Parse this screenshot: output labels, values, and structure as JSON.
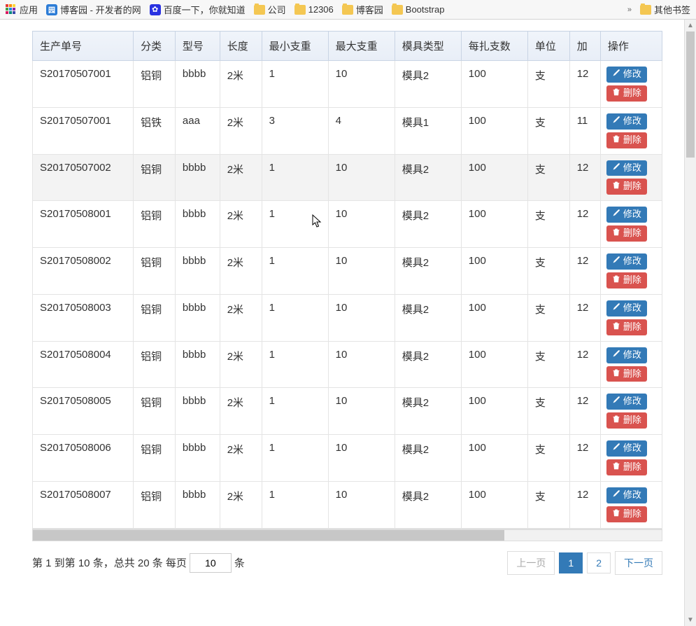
{
  "bookmarks": {
    "apps": "应用",
    "cnblogs": "博客园 - 开发者的网",
    "baidu": "百度一下，你就知道",
    "folders": [
      "公司",
      "12306",
      "博客园",
      "Bootstrap"
    ],
    "more": "»",
    "other": "其他书签"
  },
  "table": {
    "headers": [
      "生产单号",
      "分类",
      "型号",
      "长度",
      "最小支重",
      "最大支重",
      "模具类型",
      "每扎支数",
      "单位",
      "加",
      "操作"
    ],
    "edit_label": "修改",
    "delete_label": "删除",
    "rows": [
      {
        "no": "S20170507001",
        "cat": "铝铜",
        "model": "bbbb",
        "len": "2米",
        "min": "1",
        "max": "10",
        "mold": "模具2",
        "per": "100",
        "unit": "支",
        "add": "12"
      },
      {
        "no": "S20170507001",
        "cat": "铝铁",
        "model": "aaa",
        "len": "2米",
        "min": "3",
        "max": "4",
        "mold": "模具1",
        "per": "100",
        "unit": "支",
        "add": "11"
      },
      {
        "no": "S20170507002",
        "cat": "铝铜",
        "model": "bbbb",
        "len": "2米",
        "min": "1",
        "max": "10",
        "mold": "模具2",
        "per": "100",
        "unit": "支",
        "add": "12"
      },
      {
        "no": "S20170508001",
        "cat": "铝铜",
        "model": "bbbb",
        "len": "2米",
        "min": "1",
        "max": "10",
        "mold": "模具2",
        "per": "100",
        "unit": "支",
        "add": "12"
      },
      {
        "no": "S20170508002",
        "cat": "铝铜",
        "model": "bbbb",
        "len": "2米",
        "min": "1",
        "max": "10",
        "mold": "模具2",
        "per": "100",
        "unit": "支",
        "add": "12"
      },
      {
        "no": "S20170508003",
        "cat": "铝铜",
        "model": "bbbb",
        "len": "2米",
        "min": "1",
        "max": "10",
        "mold": "模具2",
        "per": "100",
        "unit": "支",
        "add": "12"
      },
      {
        "no": "S20170508004",
        "cat": "铝铜",
        "model": "bbbb",
        "len": "2米",
        "min": "1",
        "max": "10",
        "mold": "模具2",
        "per": "100",
        "unit": "支",
        "add": "12"
      },
      {
        "no": "S20170508005",
        "cat": "铝铜",
        "model": "bbbb",
        "len": "2米",
        "min": "1",
        "max": "10",
        "mold": "模具2",
        "per": "100",
        "unit": "支",
        "add": "12"
      },
      {
        "no": "S20170508006",
        "cat": "铝铜",
        "model": "bbbb",
        "len": "2米",
        "min": "1",
        "max": "10",
        "mold": "模具2",
        "per": "100",
        "unit": "支",
        "add": "12"
      },
      {
        "no": "S20170508007",
        "cat": "铝铜",
        "model": "bbbb",
        "len": "2米",
        "min": "1",
        "max": "10",
        "mold": "模具2",
        "per": "100",
        "unit": "支",
        "add": "12"
      }
    ]
  },
  "pager": {
    "info_prefix": "第 1 到第 10 条，总共 20 条 每页",
    "info_suffix": "条",
    "page_size": "10",
    "prev": "上一页",
    "next": "下一页",
    "pages": [
      "1",
      "2"
    ]
  }
}
